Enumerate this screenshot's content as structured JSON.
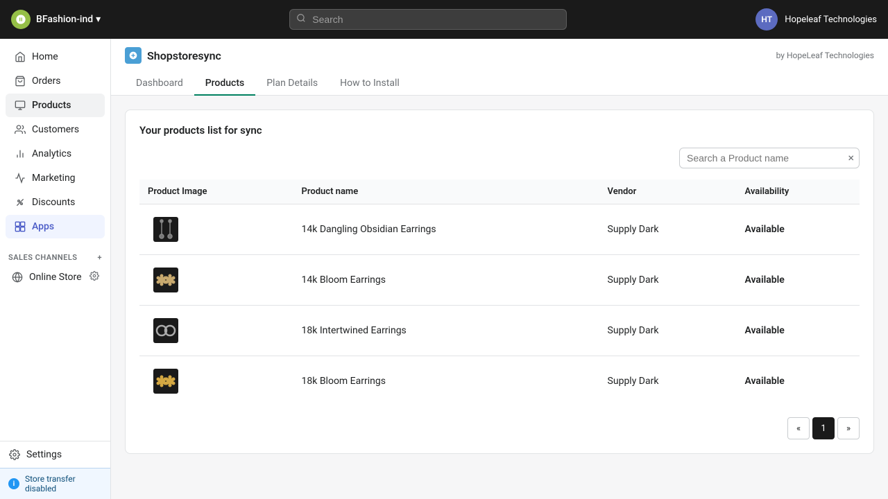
{
  "topbar": {
    "store_name": "BFashion-ind",
    "store_name_arrow": "▾",
    "search_placeholder": "Search",
    "avatar_initials": "HT",
    "company": "Hopeleaf Technologies"
  },
  "sidebar": {
    "nav_items": [
      {
        "id": "home",
        "label": "Home",
        "icon": "home"
      },
      {
        "id": "orders",
        "label": "Orders",
        "icon": "orders"
      },
      {
        "id": "products",
        "label": "Products",
        "icon": "products",
        "active": true
      },
      {
        "id": "customers",
        "label": "Customers",
        "icon": "customers"
      },
      {
        "id": "analytics",
        "label": "Analytics",
        "icon": "analytics"
      },
      {
        "id": "marketing",
        "label": "Marketing",
        "icon": "marketing"
      },
      {
        "id": "discounts",
        "label": "Discounts",
        "icon": "discounts"
      },
      {
        "id": "apps",
        "label": "Apps",
        "icon": "apps",
        "highlighted": true
      }
    ],
    "sales_channels_label": "SALES CHANNELS",
    "sales_channels": [
      {
        "id": "online-store",
        "label": "Online Store"
      }
    ],
    "settings_label": "Settings",
    "store_transfer_label": "Store transfer disabled"
  },
  "app": {
    "logo_text": "S",
    "name": "Shopstoresync",
    "by_text": "by HopeLeaf Technologies",
    "tabs": [
      {
        "id": "dashboard",
        "label": "Dashboard",
        "active": false
      },
      {
        "id": "products",
        "label": "Products",
        "active": true
      },
      {
        "id": "plan-details",
        "label": "Plan Details",
        "active": false
      },
      {
        "id": "how-to-install",
        "label": "How to Install",
        "active": false
      }
    ]
  },
  "products_page": {
    "title": "Your products list for sync",
    "search_placeholder": "Search a Product name",
    "table_headers": [
      "Product Image",
      "Product name",
      "Vendor",
      "Availability"
    ],
    "products": [
      {
        "id": 1,
        "name": "14k Dangling Obsidian Earrings",
        "vendor": "Supply Dark",
        "availability": "Available",
        "img_bg": "#1a1a1a",
        "img_desc": "dangling earrings"
      },
      {
        "id": 2,
        "name": "14k Bloom Earrings",
        "vendor": "Supply Dark",
        "availability": "Available",
        "img_bg": "#1a1a1a",
        "img_desc": "bloom earrings"
      },
      {
        "id": 3,
        "name": "18k Intertwined Earrings",
        "vendor": "Supply Dark",
        "availability": "Available",
        "img_bg": "#1a1a1a",
        "img_desc": "intertwined earrings"
      },
      {
        "id": 4,
        "name": "18k Bloom Earrings",
        "vendor": "Supply Dark",
        "availability": "Available",
        "img_bg": "#1a1a1a",
        "img_desc": "bloom earrings 18k"
      }
    ],
    "pagination": {
      "prev": "«",
      "current": "1",
      "next": "»"
    }
  }
}
